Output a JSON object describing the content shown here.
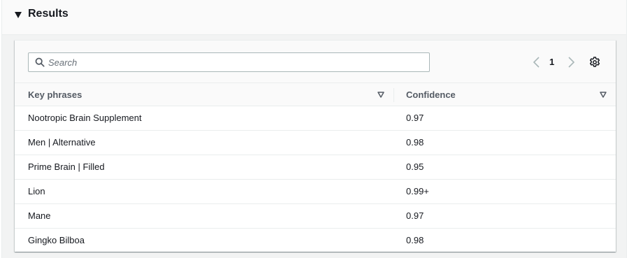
{
  "results": {
    "title": "Results",
    "expanded": true
  },
  "search": {
    "placeholder": "Search",
    "value": ""
  },
  "pagination": {
    "current_page": "1"
  },
  "table": {
    "columns": [
      "Key phrases",
      "Confidence"
    ],
    "rows": [
      {
        "phrase": "Nootropic Brain Supplement",
        "confidence": "0.97"
      },
      {
        "phrase": "Men | Alternative",
        "confidence": "0.98"
      },
      {
        "phrase": "Prime Brain | Filled",
        "confidence": "0.95"
      },
      {
        "phrase": "Lion",
        "confidence": "0.99+"
      },
      {
        "phrase": "Mane",
        "confidence": "0.97"
      },
      {
        "phrase": "Gingko Bilboa",
        "confidence": "0.98"
      }
    ]
  },
  "icons": {
    "expand": "caret-down-icon",
    "search": "search-icon",
    "prev": "chevron-left-icon",
    "next": "chevron-right-icon",
    "settings": "gear-icon",
    "sort": "sort-caret-icon"
  },
  "colors": {
    "panel_bg": "#f2f3f3",
    "header_bg": "#fafafa",
    "text": "#16191f",
    "muted_text": "#545b64",
    "border": "#eaeded",
    "input_border": "#aab7b8",
    "disabled_icon": "#aab7b8"
  }
}
